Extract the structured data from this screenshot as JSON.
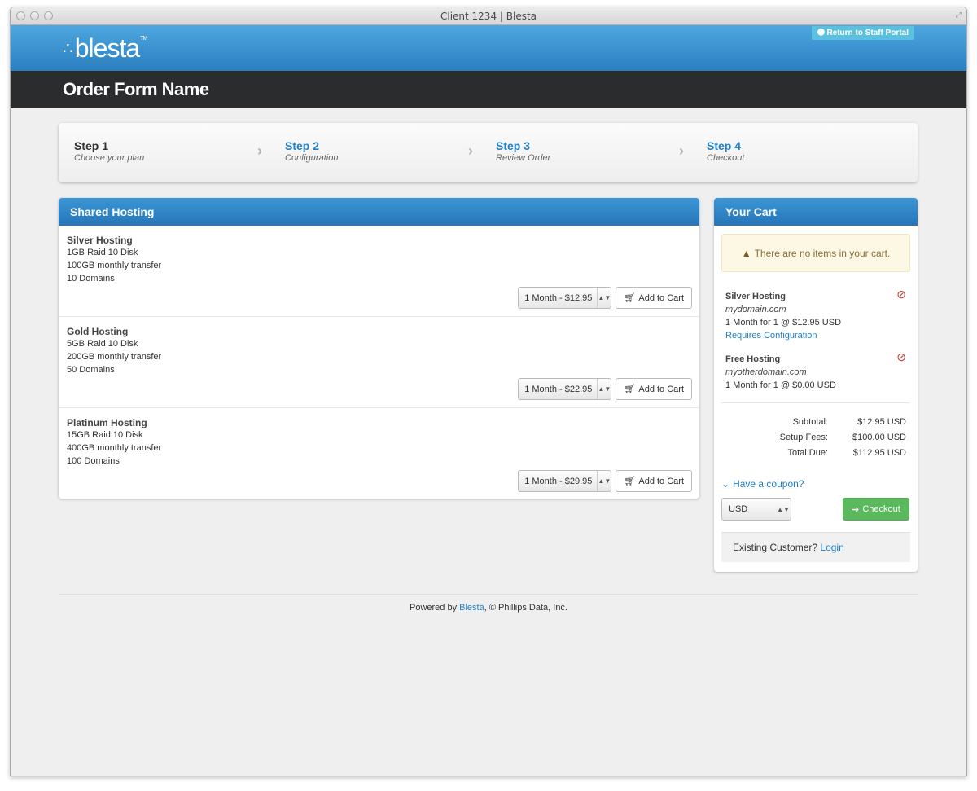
{
  "window": {
    "title": "Client 1234 | Blesta"
  },
  "header": {
    "logo_text": "blesta",
    "logo_tm": "TM",
    "staff_portal_label": "Return to Staff Portal",
    "page_title": "Order Form Name"
  },
  "steps": [
    {
      "title": "Step 1",
      "subtitle": "Choose your plan"
    },
    {
      "title": "Step 2",
      "subtitle": "Configuration"
    },
    {
      "title": "Step 3",
      "subtitle": "Review Order"
    },
    {
      "title": "Step 4",
      "subtitle": "Checkout"
    }
  ],
  "plans_panel": {
    "title": "Shared Hosting",
    "add_label": "Add to Cart",
    "plans": [
      {
        "name": "Silver Hosting",
        "features": [
          "1GB Raid 10 Disk",
          "100GB monthly transfer",
          "10 Domains"
        ],
        "term": "1 Month - $12.95"
      },
      {
        "name": "Gold Hosting",
        "features": [
          "5GB Raid 10 Disk",
          "200GB monthly transfer",
          "50 Domains"
        ],
        "term": "1 Month - $22.95"
      },
      {
        "name": "Platinum Hosting",
        "features": [
          "15GB Raid 10 Disk",
          "400GB monthly transfer",
          "100 Domains"
        ],
        "term": "1 Month - $29.95"
      }
    ]
  },
  "cart": {
    "title": "Your Cart",
    "empty_alert": "There are no items in your cart.",
    "items": [
      {
        "name": "Silver Hosting",
        "domain": "mydomain.com",
        "detail": "1 Month for 1 @ $12.95 USD",
        "link": "Requires Configuration"
      },
      {
        "name": "Free Hosting",
        "domain": "myotherdomain.com",
        "detail": "1 Month for 1 @ $0.00 USD"
      }
    ],
    "totals": {
      "subtotal_label": "Subtotal:",
      "subtotal": "$12.95 USD",
      "setup_label": "Setup Fees:",
      "setup": "$100.00 USD",
      "total_label": "Total Due:",
      "total": "$112.95 USD"
    },
    "coupon_label": "Have a coupon?",
    "currency": "USD",
    "checkout_label": "Checkout",
    "existing_text": "Existing Customer?",
    "login_label": "Login"
  },
  "footer": {
    "prefix": "Powered by",
    "link": "Blesta",
    "suffix": ", © Phillips Data, Inc."
  },
  "colors": {
    "brand_blue": "#2a7fc0",
    "dark_bar": "#2b2c2e",
    "checkout_green": "#5cb85c",
    "alert_bg": "#fcf8e3",
    "remove_red": "#c0392b"
  }
}
